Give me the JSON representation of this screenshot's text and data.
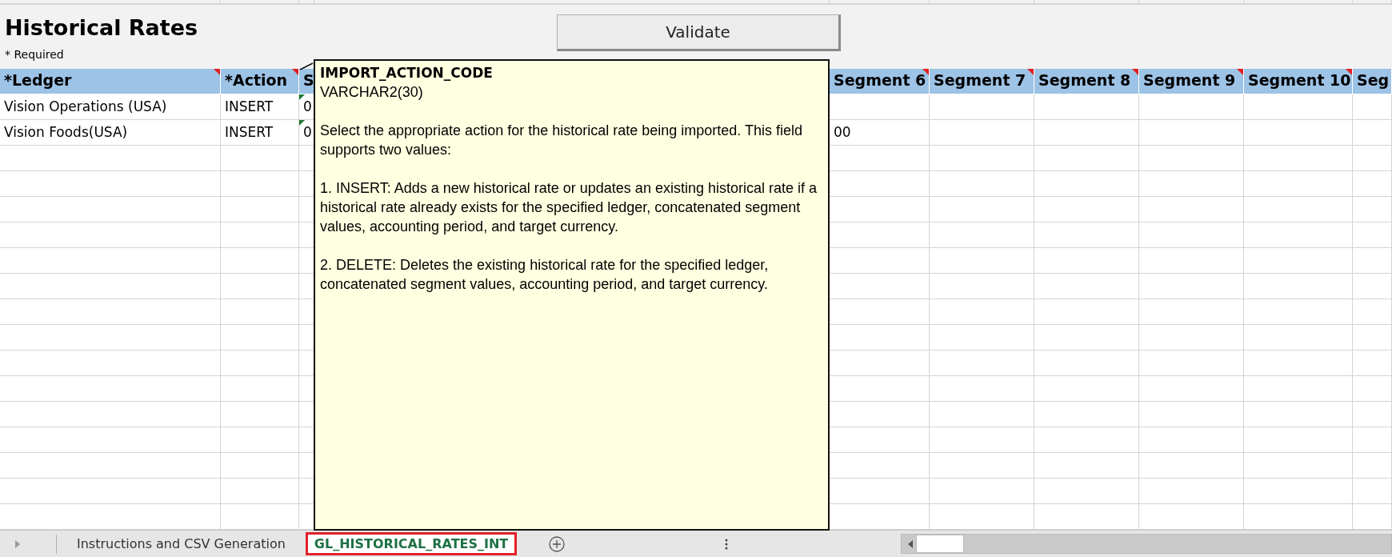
{
  "sheet": {
    "title": "Historical Rates",
    "note": "* Required",
    "validate_button": "Validate"
  },
  "columns": [
    {
      "label": "*Ledger",
      "comment": true
    },
    {
      "label": "*Action",
      "comment": true
    },
    {
      "label": "S",
      "comment": false
    },
    {
      "label": "Segment 6",
      "comment": true
    },
    {
      "label": "Segment 7",
      "comment": true
    },
    {
      "label": "Segment 8",
      "comment": true
    },
    {
      "label": "Segment 9",
      "comment": true
    },
    {
      "label": "Segment 10",
      "comment": true
    },
    {
      "label": "Seg",
      "comment": false
    }
  ],
  "rows": [
    {
      "ledger": "Vision Operations (USA)",
      "action": "INSERT",
      "column_3": "0",
      "column_3_flag": true
    },
    {
      "ledger": "Vision Foods(USA)",
      "action": "INSERT",
      "column_3": "0",
      "column_3_flag": true,
      "segment_6": "00"
    }
  ],
  "tooltip": {
    "title": "IMPORT_ACTION_CODE",
    "type": "VARCHAR2(30)",
    "paragraphs": [
      "Select the appropriate action for the historical rate being imported. This field supports two values:",
      "1. INSERT: Adds a new historical rate or updates an existing historical rate if a historical rate already exists for the specified ledger, concatenated segment values, accounting period, and target currency.",
      "2. DELETE: Deletes the existing historical rate for the specified ledger, concatenated segment values, accounting period, and target currency."
    ]
  },
  "sheet_tabs": [
    {
      "label": "Instructions and CSV Generation",
      "selected": false
    },
    {
      "label": "GL_HISTORICAL_RATES_INT",
      "selected": true
    }
  ]
}
